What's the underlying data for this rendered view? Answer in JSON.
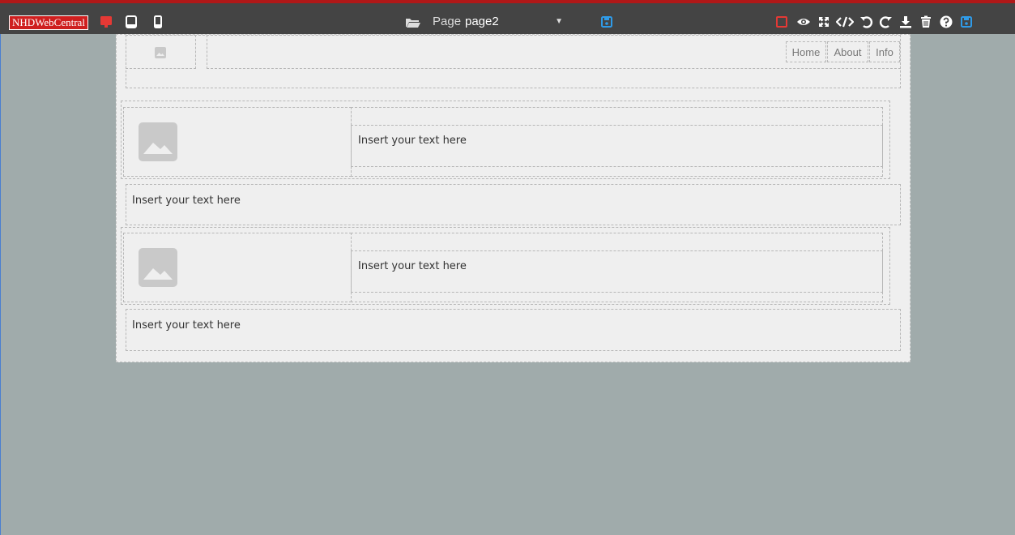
{
  "topbar": {
    "brand": "NHDWebCentral",
    "page_label": "Page",
    "page_select": "page2",
    "accent": "#e53935",
    "save_color": "#2f9be8",
    "icons": [
      "desktop-icon",
      "tablet-icon",
      "mobile-icon",
      "folder-icon",
      "save-icon",
      "square-outline-icon",
      "eye-icon",
      "fullscreen-icon",
      "code-icon",
      "undo-icon",
      "redo-icon",
      "download-icon",
      "trash-icon",
      "help-icon",
      "save-icon"
    ]
  },
  "header_block": {
    "nav": [
      "Home",
      "About",
      "Info"
    ]
  },
  "sections": [
    {
      "image": "image-placeholder-icon",
      "text": "Insert your text here"
    },
    {
      "text": "Insert your text here"
    },
    {
      "image": "image-placeholder-icon",
      "text": "Insert your text here"
    },
    {
      "text": "Insert your text here"
    }
  ]
}
